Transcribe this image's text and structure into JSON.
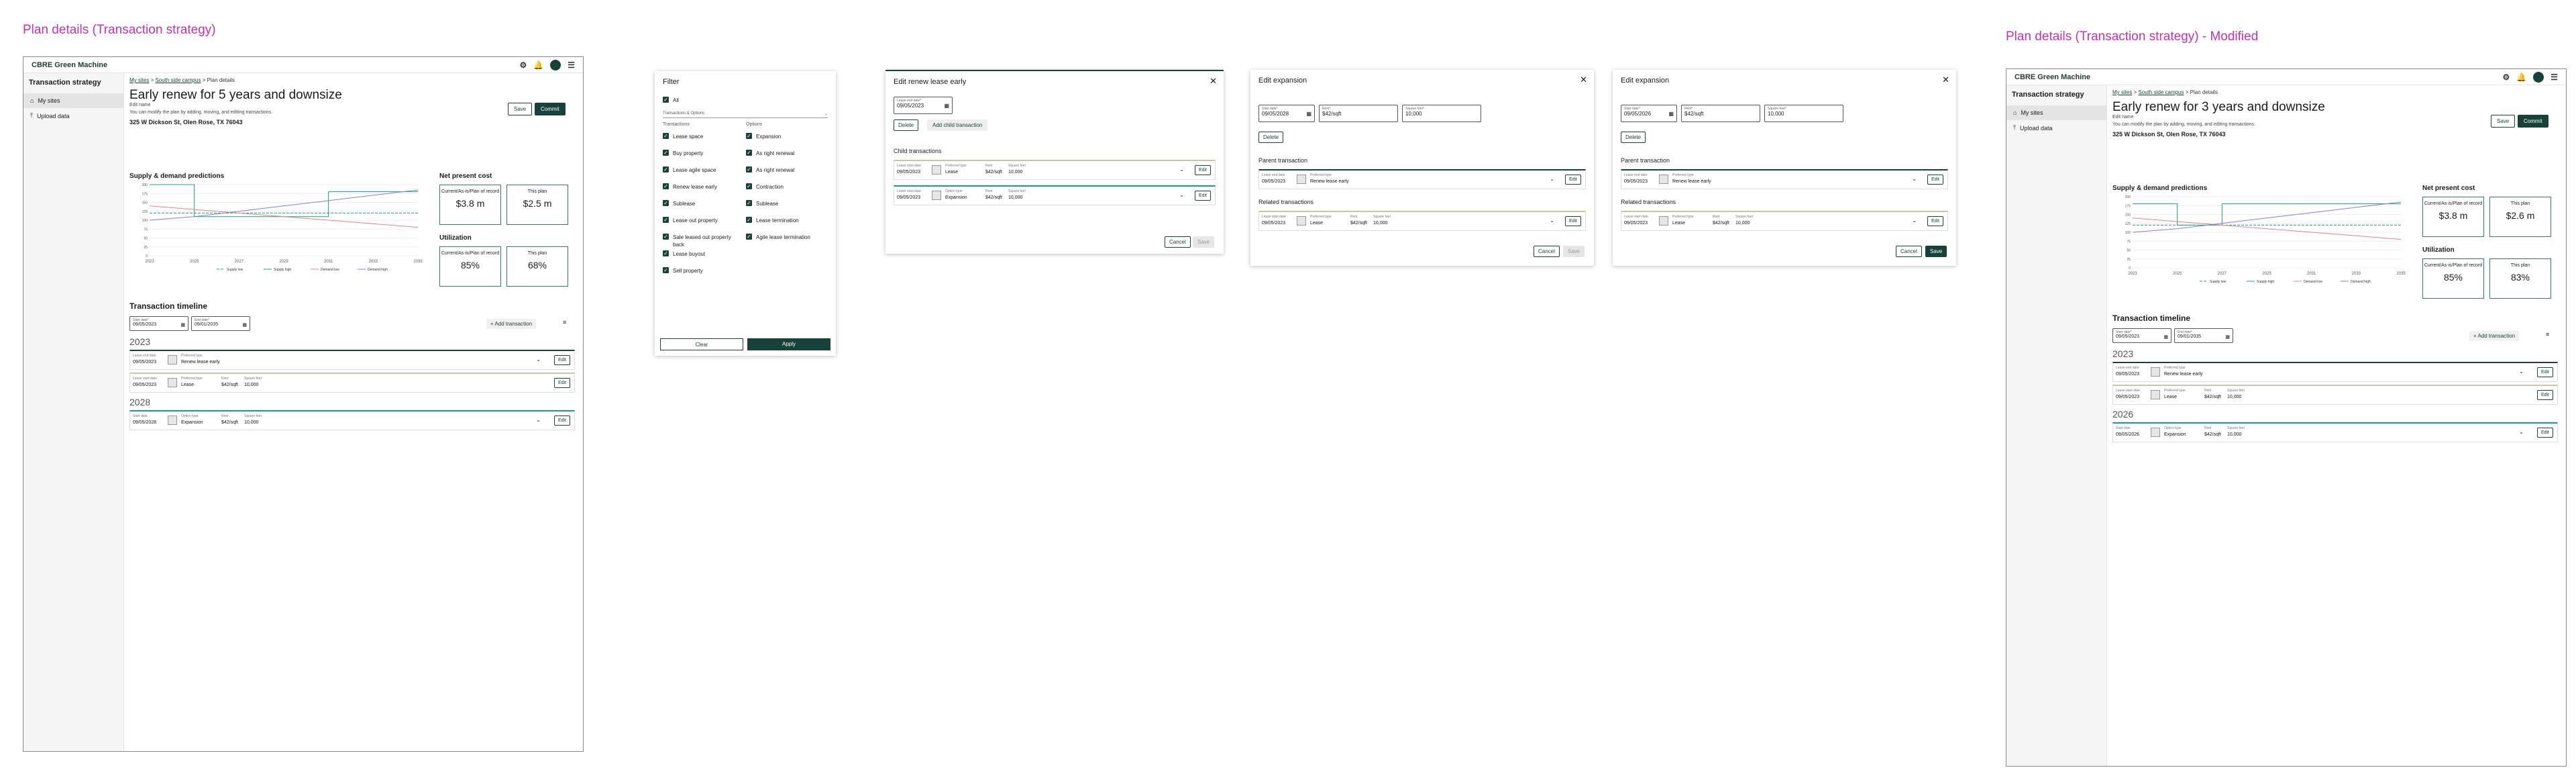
{
  "section_titles": {
    "left": "Plan details (Transaction strategy)",
    "right": "Plan details (Transaction strategy) - Modified"
  },
  "app": {
    "title": "CBRE Green Machine"
  },
  "sidebar": {
    "title": "Transaction strategy",
    "items": [
      {
        "label": "My sites"
      },
      {
        "label": "Upload data"
      }
    ]
  },
  "screen1": {
    "breadcrumb": {
      "a": "My sites",
      "b": "South side campus",
      "c": "Plan details"
    },
    "title": "Early renew for 5 years and downsize",
    "edit_note": "Edit name",
    "description": "You can modify the plan by adding, moving, and editing transactions.",
    "address": "325 W Dickson St, Olen Rose, TX 76043",
    "save": "Save",
    "commit": "Commit",
    "chart_title": "Supply & demand predictions",
    "npv_title": "Net present cost",
    "npv_record_label": "Current/As-is/Plan of record",
    "npv_record": "$3.8 m",
    "npv_plan_label": "This plan",
    "npv_plan": "$2.5 m",
    "util_title": "Utilization",
    "util_record_label": "Current/As-is/Plan of record",
    "util_record": "85%",
    "util_plan_label": "This plan",
    "util_plan": "68%",
    "timeline_title": "Transaction timeline",
    "start_label": "Start date*",
    "start_value": "09/05/2023",
    "end_label": "End date*",
    "end_value": "09/01/2035",
    "add_transaction": "Add transaction",
    "year1": "2023",
    "year2": "2028",
    "rows": [
      {
        "f1l": "Lease end date",
        "f1": "09/05/2023",
        "f2l": "Preferred type",
        "f2": "Renew lease early",
        "f3l": "",
        "f3": "",
        "f4l": "",
        "f4": ""
      },
      {
        "f1l": "Lease start date",
        "f1": "09/05/2023",
        "f2l": "Preferred type",
        "f2": "Lease",
        "f3l": "Rent",
        "f3": "$42/sqft",
        "f4l": "Square feet",
        "f4": "10,000"
      },
      {
        "f1l": "Start date",
        "f1": "09/05/2028",
        "f2l": "Option type",
        "f2": "Expansion",
        "f3l": "Rent",
        "f3": "$42/sqft",
        "f4l": "Square feet",
        "f4": "10,000"
      }
    ],
    "edit": "Edit"
  },
  "screen2": {
    "breadcrumb": {
      "a": "My sites",
      "b": "South side campus",
      "c": "Plan details"
    },
    "title": "Early renew for 3 years and downsize",
    "edit_note": "Edit name",
    "description": "You can modify the plan by adding, moving, and editing transactions.",
    "address": "325 W Dickson St, Olen Rose, TX 76043",
    "save": "Save",
    "commit": "Commit",
    "chart_title": "Supply & demand predictions",
    "npv_title": "Net present cost",
    "npv_record_label": "Current/As-is/Plan of record",
    "npv_record": "$3.8 m",
    "npv_plan_label": "This plan",
    "npv_plan": "$2.6 m",
    "util_title": "Utilization",
    "util_record_label": "Current/As-is/Plan of record",
    "util_record": "85%",
    "util_plan_label": "This plan",
    "util_plan": "83%",
    "timeline_title": "Transaction timeline",
    "start_label": "Start date*",
    "start_value": "09/05/2023",
    "end_label": "End date*",
    "end_value": "09/01/2035",
    "add_transaction": "Add transaction",
    "year1": "2023",
    "year2": "2026",
    "rows": [
      {
        "f1l": "Lease end date",
        "f1": "09/05/2023",
        "f2l": "Preferred type",
        "f2": "Renew lease early",
        "f3l": "",
        "f3": "",
        "f4l": "",
        "f4": ""
      },
      {
        "f1l": "Lease start date",
        "f1": "09/05/2023",
        "f2l": "Preferred type",
        "f2": "Lease",
        "f3l": "Rent",
        "f3": "$42/sqft",
        "f4l": "Square feet",
        "f4": "10,000"
      },
      {
        "f1l": "Start date",
        "f1": "09/05/2026",
        "f2l": "Option type",
        "f2": "Expansion",
        "f3l": "Rent",
        "f3": "$42/sqft",
        "f4l": "Square feet",
        "f4": "10,000"
      }
    ],
    "edit": "Edit"
  },
  "filter": {
    "title": "Filter",
    "all": "All",
    "dropdown": "Transactions & Options",
    "col_transactions": "Transactions",
    "col_options": "Options",
    "transactions": [
      "Lease space",
      "Buy property",
      "Lease agile space",
      "Renew lease early",
      "Sublease",
      "Lease out property",
      "Sale leased out property back",
      "Lease buyout",
      "Sell property"
    ],
    "options": [
      "Expansion",
      "As right renewal",
      "As right renewal",
      "Contraction",
      "Sublease",
      "Lease termination",
      "Agile lease termination"
    ],
    "clear": "Clear",
    "apply": "Apply"
  },
  "renew_dialog": {
    "title": "Edit renew lease early",
    "date_label": "Lease end date*",
    "date_value": "09/05/2023",
    "delete": "Delete",
    "add_child": "Add child transaction",
    "child_title": "Child transactions",
    "rows": [
      {
        "f1l": "Lease start date",
        "f1": "09/05/2023",
        "f2l": "Preferred type",
        "f2": "Lease",
        "f3l": "Rent",
        "f3": "$42/sqft",
        "f4l": "Square feet",
        "f4": "10,000"
      },
      {
        "f1l": "Lease start date",
        "f1": "09/05/2023",
        "f2l": "Option type",
        "f2": "Expansion",
        "f3l": "Rent",
        "f3": "$42/sqft",
        "f4l": "Square feet",
        "f4": "10,000"
      }
    ],
    "edit": "Edit",
    "cancel": "Cancel",
    "save": "Save"
  },
  "expansion_dialogs": [
    {
      "title": "Edit expansion",
      "start_label": "Start date*",
      "start_value": "09/05/2028",
      "rent_label": "Rent*",
      "rent_value": "$42/sqft",
      "sqft_label": "Square feet*",
      "sqft_value": "10,000",
      "delete": "Delete",
      "parent_title": "Parent transaction",
      "parent_row": {
        "f1l": "Lease end date",
        "f1": "09/05/2023",
        "f2l": "Preferred type",
        "f2": "Renew lease early"
      },
      "related_title": "Related transactions",
      "related_row": {
        "f1l": "Lease start date",
        "f1": "09/05/2023",
        "f2l": "Preferred type",
        "f2": "Lease",
        "f3l": "Rent",
        "f3": "$42/sqft",
        "f4l": "Square feet",
        "f4": "10,000"
      },
      "edit": "Edit",
      "cancel": "Cancel",
      "save": "Save"
    },
    {
      "title": "Edit expansion",
      "start_label": "Start date*",
      "start_value": "09/05/2026",
      "rent_label": "Rent*",
      "rent_value": "$42/sqft",
      "sqft_label": "Square feet*",
      "sqft_value": "10,000",
      "delete": "Delete",
      "parent_title": "Parent transaction",
      "parent_row": {
        "f1l": "Lease end date",
        "f1": "09/05/2023",
        "f2l": "Preferred type",
        "f2": "Renew lease early"
      },
      "related_title": "Related transactions",
      "related_row": {
        "f1l": "Lease start date",
        "f1": "09/05/2023",
        "f2l": "Preferred type",
        "f2": "Lease",
        "f3l": "Rent",
        "f3": "$42/sqft",
        "f4l": "Square feet",
        "f4": "10,000"
      },
      "edit": "Edit",
      "cancel": "Cancel",
      "save": "Save"
    }
  ],
  "colors": {
    "brand": "#17423a",
    "accent": "#2e7c68",
    "title_pink": "#c231b6",
    "supply": "#14a37f",
    "demand_low": "#f08080",
    "demand_high": "#8080e0"
  },
  "chart_data": [
    {
      "type": "line",
      "title": "Supply & demand predictions",
      "x": [
        "2023",
        "2025",
        "2027",
        "2029",
        "2031",
        "2033",
        "2035"
      ],
      "ylim": [
        0,
        200
      ],
      "series": [
        {
          "name": "Supply low",
          "values": [
            120,
            120,
            120,
            120,
            120,
            120,
            120
          ]
        },
        {
          "name": "Supply high",
          "values": [
            200,
            110,
            110,
            110,
            180,
            180,
            180
          ]
        },
        {
          "name": "Demand low",
          "values": [
            140,
            130,
            120,
            110,
            100,
            90,
            80
          ]
        },
        {
          "name": "Demand high",
          "values": [
            100,
            110,
            125,
            140,
            155,
            170,
            185
          ]
        }
      ]
    },
    {
      "type": "line",
      "title": "Supply & demand predictions",
      "x": [
        "2023",
        "2025",
        "2027",
        "2029",
        "2031",
        "2033",
        "2035"
      ],
      "ylim": [
        0,
        200
      ],
      "series": [
        {
          "name": "Supply low",
          "values": [
            120,
            120,
            120,
            120,
            120,
            120,
            120
          ]
        },
        {
          "name": "Supply high",
          "values": [
            180,
            120,
            180,
            180,
            180,
            180,
            180
          ]
        },
        {
          "name": "Demand low",
          "values": [
            140,
            130,
            120,
            110,
            100,
            90,
            80
          ]
        },
        {
          "name": "Demand high",
          "values": [
            100,
            110,
            125,
            140,
            155,
            170,
            185
          ]
        }
      ]
    }
  ]
}
